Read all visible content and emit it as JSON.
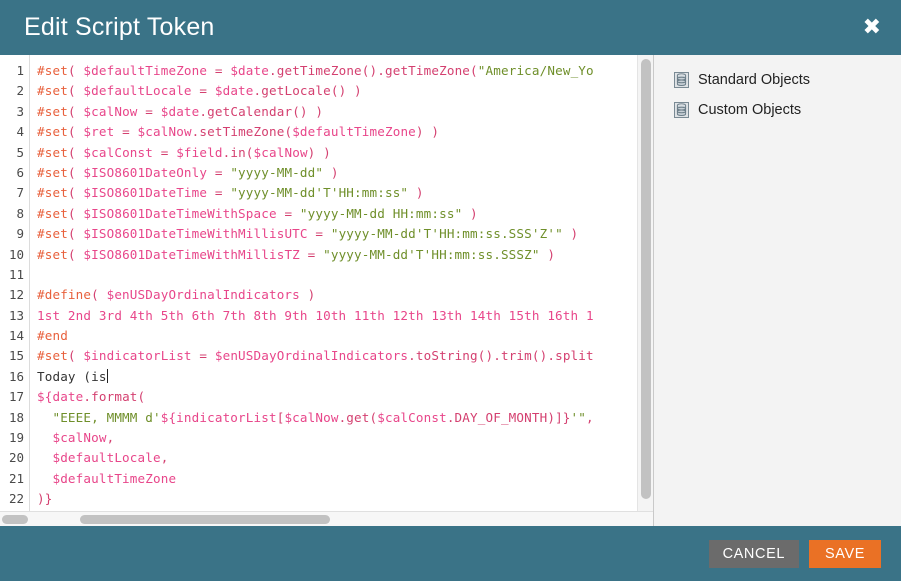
{
  "window": {
    "title": "Edit Script Token",
    "close_icon": "close-icon",
    "accent_color": "#3a7387",
    "save_color": "#ea7125",
    "cancel_color": "#6b6b6b"
  },
  "editor": {
    "line_numbers": [
      "1",
      "2",
      "3",
      "4",
      "5",
      "6",
      "7",
      "8",
      "9",
      "10",
      "11",
      "12",
      "13",
      "14",
      "15",
      "16",
      "17",
      "18",
      "19",
      "20",
      "21",
      "22"
    ],
    "lines": [
      {
        "n": "1",
        "tokens": [
          {
            "t": "#set",
            "c": "dir"
          },
          {
            "t": "( ",
            "c": "paren"
          },
          {
            "t": "$defaultTimeZone",
            "c": "var"
          },
          {
            "t": " = ",
            "c": "paren"
          },
          {
            "t": "$date",
            "c": "var"
          },
          {
            "t": ".getTimeZone().getTimeZone(",
            "c": "paren"
          },
          {
            "t": "\"America/New_Yo",
            "c": "str"
          }
        ]
      },
      {
        "n": "2",
        "tokens": [
          {
            "t": "#set",
            "c": "dir"
          },
          {
            "t": "( ",
            "c": "paren"
          },
          {
            "t": "$defaultLocale",
            "c": "var"
          },
          {
            "t": " = ",
            "c": "paren"
          },
          {
            "t": "$date",
            "c": "var"
          },
          {
            "t": ".getLocale() )",
            "c": "paren"
          }
        ]
      },
      {
        "n": "3",
        "tokens": [
          {
            "t": "#set",
            "c": "dir"
          },
          {
            "t": "( ",
            "c": "paren"
          },
          {
            "t": "$calNow",
            "c": "var"
          },
          {
            "t": " = ",
            "c": "paren"
          },
          {
            "t": "$date",
            "c": "var"
          },
          {
            "t": ".getCalendar() )",
            "c": "paren"
          }
        ]
      },
      {
        "n": "4",
        "tokens": [
          {
            "t": "#set",
            "c": "dir"
          },
          {
            "t": "( ",
            "c": "paren"
          },
          {
            "t": "$ret",
            "c": "var"
          },
          {
            "t": " = ",
            "c": "paren"
          },
          {
            "t": "$calNow",
            "c": "var"
          },
          {
            "t": ".setTimeZone(",
            "c": "paren"
          },
          {
            "t": "$defaultTimeZone",
            "c": "var"
          },
          {
            "t": ") )",
            "c": "paren"
          }
        ]
      },
      {
        "n": "5",
        "tokens": [
          {
            "t": "#set",
            "c": "dir"
          },
          {
            "t": "( ",
            "c": "paren"
          },
          {
            "t": "$calConst",
            "c": "var"
          },
          {
            "t": " = ",
            "c": "paren"
          },
          {
            "t": "$field",
            "c": "var"
          },
          {
            "t": ".in(",
            "c": "paren"
          },
          {
            "t": "$calNow",
            "c": "var"
          },
          {
            "t": ") )",
            "c": "paren"
          }
        ]
      },
      {
        "n": "6",
        "tokens": [
          {
            "t": "#set",
            "c": "dir"
          },
          {
            "t": "( ",
            "c": "paren"
          },
          {
            "t": "$ISO8601DateOnly",
            "c": "var"
          },
          {
            "t": " = ",
            "c": "paren"
          },
          {
            "t": "\"yyyy-MM-dd\"",
            "c": "str"
          },
          {
            "t": " )",
            "c": "paren"
          }
        ]
      },
      {
        "n": "7",
        "tokens": [
          {
            "t": "#set",
            "c": "dir"
          },
          {
            "t": "( ",
            "c": "paren"
          },
          {
            "t": "$ISO8601DateTime",
            "c": "var"
          },
          {
            "t": " = ",
            "c": "paren"
          },
          {
            "t": "\"yyyy-MM-dd'T'HH:mm:ss\"",
            "c": "str"
          },
          {
            "t": " )",
            "c": "paren"
          }
        ]
      },
      {
        "n": "8",
        "tokens": [
          {
            "t": "#set",
            "c": "dir"
          },
          {
            "t": "( ",
            "c": "paren"
          },
          {
            "t": "$ISO8601DateTimeWithSpace",
            "c": "var"
          },
          {
            "t": " = ",
            "c": "paren"
          },
          {
            "t": "\"yyyy-MM-dd HH:mm:ss\"",
            "c": "str"
          },
          {
            "t": " )",
            "c": "paren"
          }
        ]
      },
      {
        "n": "9",
        "tokens": [
          {
            "t": "#set",
            "c": "dir"
          },
          {
            "t": "( ",
            "c": "paren"
          },
          {
            "t": "$ISO8601DateTimeWithMillisUTC",
            "c": "var"
          },
          {
            "t": " = ",
            "c": "paren"
          },
          {
            "t": "\"yyyy-MM-dd'T'HH:mm:ss.SSS'Z'\"",
            "c": "str"
          },
          {
            "t": " )",
            "c": "paren"
          }
        ]
      },
      {
        "n": "10",
        "tokens": [
          {
            "t": "#set",
            "c": "dir"
          },
          {
            "t": "( ",
            "c": "paren"
          },
          {
            "t": "$ISO8601DateTimeWithMillisTZ",
            "c": "var"
          },
          {
            "t": " = ",
            "c": "paren"
          },
          {
            "t": "\"yyyy-MM-dd'T'HH:mm:ss.SSSZ\"",
            "c": "str"
          },
          {
            "t": " )",
            "c": "paren"
          }
        ]
      },
      {
        "n": "11",
        "tokens": []
      },
      {
        "n": "12",
        "tokens": [
          {
            "t": "#define",
            "c": "dir"
          },
          {
            "t": "( ",
            "c": "paren"
          },
          {
            "t": "$enUSDayOrdinalIndicators",
            "c": "var"
          },
          {
            "t": " )",
            "c": "paren"
          }
        ]
      },
      {
        "n": "13",
        "tokens": [
          {
            "t": "1st 2nd 3rd 4th 5th 6th 7th 8th 9th 10th 11th 12th 13th 14th 15th 16th 1",
            "c": "ord"
          }
        ]
      },
      {
        "n": "14",
        "tokens": [
          {
            "t": "#end",
            "c": "dir"
          }
        ]
      },
      {
        "n": "15",
        "tokens": [
          {
            "t": "#set",
            "c": "dir"
          },
          {
            "t": "( ",
            "c": "paren"
          },
          {
            "t": "$indicatorList",
            "c": "var"
          },
          {
            "t": " = ",
            "c": "paren"
          },
          {
            "t": "$enUSDayOrdinalIndicators",
            "c": "var"
          },
          {
            "t": ".toString().trim().split",
            "c": "paren"
          }
        ]
      },
      {
        "n": "16",
        "tokens": [
          {
            "t": "Today (is",
            "c": "plain"
          }
        ],
        "caret": true
      },
      {
        "n": "17",
        "tokens": [
          {
            "t": "${date",
            "c": "var"
          },
          {
            "t": ".format(",
            "c": "paren"
          }
        ]
      },
      {
        "n": "18",
        "tokens": [
          {
            "t": "  ",
            "c": "plain"
          },
          {
            "t": "\"EEEE, MMMM d'",
            "c": "str"
          },
          {
            "t": "${indicatorList",
            "c": "var"
          },
          {
            "t": "[",
            "c": "paren"
          },
          {
            "t": "$calNow",
            "c": "var"
          },
          {
            "t": ".get(",
            "c": "paren"
          },
          {
            "t": "$calConst",
            "c": "var"
          },
          {
            "t": ".DAY_OF_MONTH)]}",
            "c": "paren"
          },
          {
            "t": "'\"",
            "c": "str"
          },
          {
            "t": ",",
            "c": "paren"
          }
        ]
      },
      {
        "n": "19",
        "tokens": [
          {
            "t": "  ",
            "c": "plain"
          },
          {
            "t": "$calNow",
            "c": "var"
          },
          {
            "t": ",",
            "c": "paren"
          }
        ]
      },
      {
        "n": "20",
        "tokens": [
          {
            "t": "  ",
            "c": "plain"
          },
          {
            "t": "$defaultLocale",
            "c": "var"
          },
          {
            "t": ",",
            "c": "paren"
          }
        ]
      },
      {
        "n": "21",
        "tokens": [
          {
            "t": "  ",
            "c": "plain"
          },
          {
            "t": "$defaultTimeZone",
            "c": "var"
          }
        ]
      },
      {
        "n": "22",
        "tokens": [
          {
            "t": ")}",
            "c": "paren"
          }
        ]
      }
    ]
  },
  "sidebar": {
    "items": [
      {
        "label": "Standard Objects",
        "icon": "database-icon"
      },
      {
        "label": "Custom Objects",
        "icon": "database-icon"
      }
    ]
  },
  "footer": {
    "cancel_label": "CANCEL",
    "save_label": "SAVE"
  }
}
